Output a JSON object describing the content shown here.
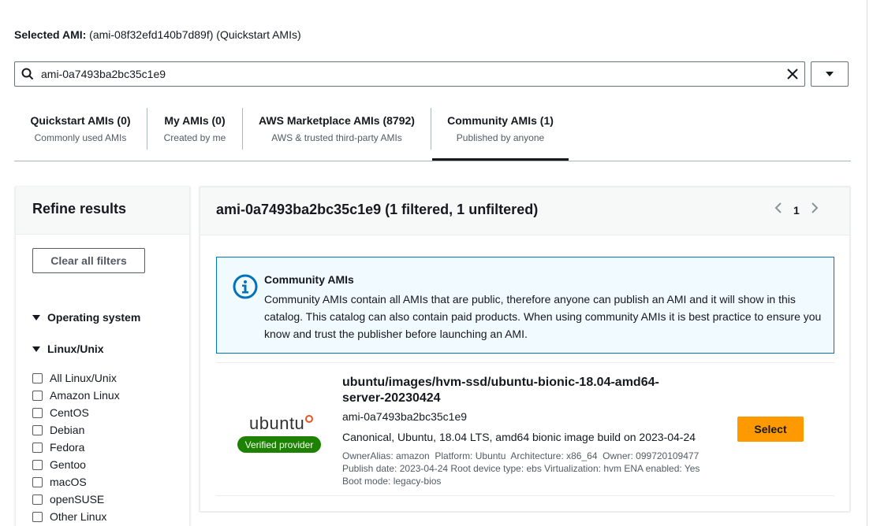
{
  "selected_ami": {
    "label": "Selected AMI:",
    "value": "(ami-08f32efd140b7d89f) (Quickstart AMIs)"
  },
  "search": {
    "value": "ami-0a7493ba2bc35c1e9",
    "search_icon": "search-icon",
    "clear_icon": "close-icon",
    "dropdown_icon": "caret-down-icon"
  },
  "tabs": [
    {
      "title": "Quickstart AMIs (0)",
      "subtitle": "Commonly used AMIs"
    },
    {
      "title": "My AMIs (0)",
      "subtitle": "Created by me"
    },
    {
      "title": "AWS Marketplace AMIs (8792)",
      "subtitle": "AWS & trusted third-party AMIs"
    },
    {
      "title": "Community AMIs (1)",
      "subtitle": "Published by anyone",
      "active": true
    }
  ],
  "sidebar": {
    "title": "Refine results",
    "clear_label": "Clear all filters",
    "os_section": "Operating system",
    "linux_section": "Linux/Unix",
    "linux_options": [
      "All Linux/Unix",
      "Amazon Linux",
      "CentOS",
      "Debian",
      "Fedora",
      "Gentoo",
      "macOS",
      "openSUSE",
      "Other Linux"
    ]
  },
  "results": {
    "title": "ami-0a7493ba2bc35c1e9 (1 filtered, 1 unfiltered)",
    "page": "1",
    "info": {
      "title": "Community AMIs",
      "body": "Community AMIs contain all AMIs that are public, therefore anyone can publish an AMI and it will show in this catalog. This catalog can also contain paid products. When using community AMIs it is best practice to ensure you know and trust the publisher before launching an AMI."
    },
    "ami": {
      "logo_text": "ubuntu",
      "badge": "Verified provider",
      "name": "ubuntu/images/hvm-ssd/ubuntu-bionic-18.04-amd64-server-20230424",
      "id": "ami-0a7493ba2bc35c1e9",
      "description": "Canonical, Ubuntu, 18.04 LTS, amd64 bionic image build on 2023-04-24",
      "meta_line1": "OwnerAlias: amazon  Platform: Ubuntu  Architecture: x86_64  Owner: 099720109477",
      "meta_line2": "Publish date: 2023-04-24 Root device type: ebs Virtualization: hvm ENA enabled: Yes",
      "meta_line3": "Boot mode: legacy-bios",
      "select_label": "Select"
    }
  },
  "colors": {
    "accent_orange": "#ff9900",
    "info_blue": "#0073bb",
    "verified_green": "#1d8102"
  }
}
